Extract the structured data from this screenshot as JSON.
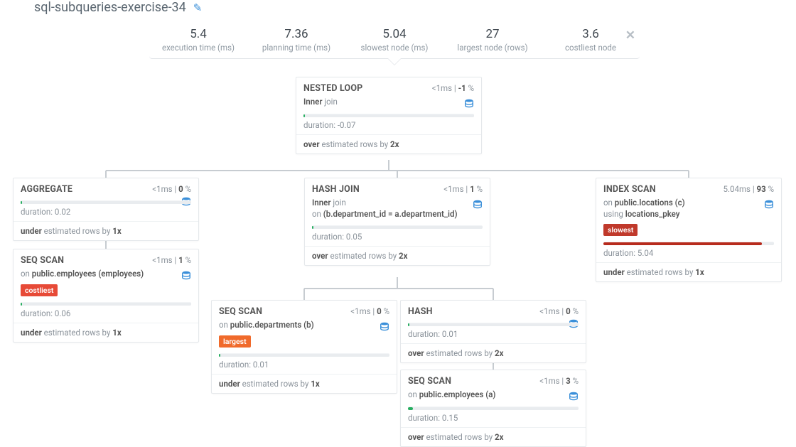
{
  "title": "sql-subqueries-exercise-34",
  "metrics": {
    "exec_value": "5.4",
    "exec_label": "execution time (ms)",
    "plan_value": "7.36",
    "plan_label": "planning time (ms)",
    "slow_value": "5.04",
    "slow_label": "slowest node (ms)",
    "large_value": "27",
    "large_label": "largest node (rows)",
    "cost_value": "3.6",
    "cost_label": "costliest node"
  },
  "labels": {
    "duration": "duration:",
    "over_prefix": "over",
    "under_prefix": "under",
    "est_mid": " estimated rows by ",
    "inner": "Inner",
    "join": " join",
    "on": "on ",
    "using": "using "
  },
  "nodes": {
    "root": {
      "title": "NESTED LOOP",
      "time": "<1",
      "pct": "-1",
      "sub_join": true,
      "duration": "-0.07",
      "bar_pct": "0",
      "est_kind": "over",
      "est_x": "2"
    },
    "aggregate": {
      "title": "AGGREGATE",
      "time": "<1",
      "pct": "0",
      "duration": "0.02",
      "bar_pct": "1",
      "est_kind": "under",
      "est_x": "1"
    },
    "hashjoin": {
      "title": "HASH JOIN",
      "time": "<1",
      "pct": "1",
      "sub_join": true,
      "cond": "(b.department_id = a.department_id)",
      "duration": "0.05",
      "bar_pct": "1",
      "est_kind": "over",
      "est_x": "2"
    },
    "indexscan": {
      "title": "INDEX SCAN",
      "time": "5.04",
      "pct": "93",
      "on": "public.locations (c)",
      "using": "locations_pkey",
      "badge": "slowest",
      "bar_color": "red",
      "duration": "5.04",
      "bar_pct": "93",
      "est_kind": "under",
      "est_x": "1"
    },
    "seqemp": {
      "title": "SEQ SCAN",
      "time": "<1",
      "pct": "1",
      "on": "public.employees (employees)",
      "badge": "costliest",
      "duration": "0.06",
      "bar_pct": "1",
      "est_kind": "under",
      "est_x": "1"
    },
    "seqdep": {
      "title": "SEQ SCAN",
      "time": "<1",
      "pct": "0",
      "on": "public.departments (b)",
      "badge": "largest",
      "duration": "0.01",
      "bar_pct": "1",
      "est_kind": "under",
      "est_x": "1"
    },
    "hash": {
      "title": "HASH",
      "time": "<1",
      "pct": "0",
      "duration": "0.01",
      "bar_pct": "1",
      "est_kind": "over",
      "est_x": "2"
    },
    "seqa": {
      "title": "SEQ SCAN",
      "time": "<1",
      "pct": "3",
      "on": "public.employees (a)",
      "duration": "0.15",
      "bar_pct": "3",
      "est_kind": "over",
      "est_x": "2"
    }
  }
}
